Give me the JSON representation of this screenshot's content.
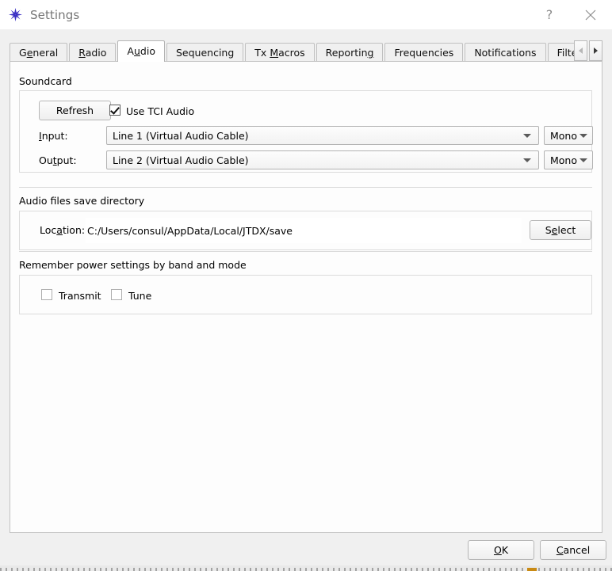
{
  "window": {
    "title": "Settings",
    "icon": "star-burst-icon",
    "help_label": "?",
    "close_label": "✕"
  },
  "tabs": {
    "items": [
      {
        "label": "General",
        "accel_index": 0,
        "selected": false
      },
      {
        "label": "Radio",
        "accel_index": 1,
        "selected": false
      },
      {
        "label": "Audio",
        "accel_index": 2,
        "selected": true
      },
      {
        "label": "Sequencing",
        "accel_index": -1,
        "selected": false
      },
      {
        "label": "Tx Macros",
        "accel_index": 3,
        "selected": false
      },
      {
        "label": "Reporting",
        "accel_index": 7,
        "selected": false
      },
      {
        "label": "Frequencies",
        "accel_index": -1,
        "selected": false
      },
      {
        "label": "Notifications",
        "accel_index": -1,
        "selected": false
      },
      {
        "label": "Filter",
        "accel_index": -1,
        "selected": false
      }
    ],
    "scroll_left_enabled": false,
    "scroll_right_enabled": true
  },
  "audio_tab": {
    "soundcard": {
      "section_label": "Soundcard",
      "refresh_button": "Refresh",
      "use_tci_audio": {
        "label": "Use TCI Audio",
        "checked": true
      },
      "input": {
        "label": "Input:",
        "accel_index": 0,
        "device": "Line 1 (Virtual Audio Cable)",
        "channel": "Mono"
      },
      "output": {
        "label": "Output:",
        "accel_index": 2,
        "device": "Line 2 (Virtual Audio Cable)",
        "channel": "Mono"
      }
    },
    "save_directory": {
      "section_label": "Audio files save directory",
      "location_label": "Location:",
      "location_accel_index": 4,
      "location_value": "C:/Users/consul/AppData/Local/JTDX/save",
      "select_button": "Select",
      "select_accel_index": 1
    },
    "power_settings": {
      "section_label": "Remember power settings by band and mode",
      "transmit": {
        "label": "Transmit",
        "checked": false
      },
      "tune": {
        "label": "Tune",
        "checked": false
      }
    }
  },
  "footer": {
    "ok_label": "OK",
    "ok_accel_index": 0,
    "cancel_label": "Cancel",
    "cancel_accel_index": 0
  },
  "colors": {
    "window_bg": "#f0f0f0",
    "titlebar_bg": "#ffffff",
    "title_text": "#767676",
    "page_bg": "#fdfdfd",
    "tab_bg": "#f0f0f0",
    "tab_selected_bg": "#ffffff",
    "border": "#c0c0c0",
    "group_border": "#dcdcdc",
    "icon_accent": "#3b30c4"
  }
}
